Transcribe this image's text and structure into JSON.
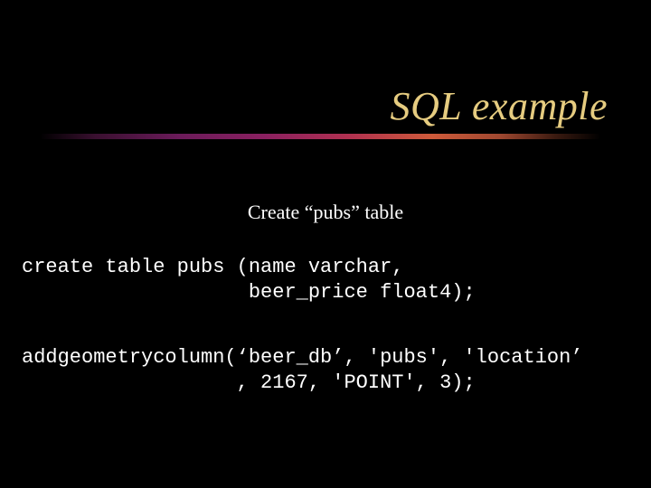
{
  "title": "SQL example",
  "subtitle": "Create “pubs” table",
  "code_block1_line1": "create table pubs (name varchar,",
  "code_block1_line2": "                   beer_price float4);",
  "code_block2_line1": "addgeometrycolumn(‘beer_db’, 'pubs', 'location’",
  "code_block2_line2": "                  , 2167, 'POINT', 3);"
}
